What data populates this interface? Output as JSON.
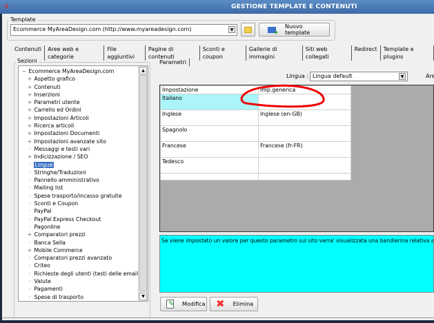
{
  "window": {
    "title": "GESTIONE TEMPLATE E CONTENUTI"
  },
  "template": {
    "group_label": "Template",
    "selected": "Ecommerce MyAreaDesign.com (http://www.myareadesign.com)",
    "new_button": "Nuovo template"
  },
  "tabs": [
    "Contenuti",
    "Aree web e categorie",
    "File aggiuntivi",
    "Pagine di contenuti",
    "Sconti e coupon",
    "Gallerie di immagini",
    "Siti web collegati",
    "Redirect",
    "Template e plugins"
  ],
  "sections": {
    "group_label": "Sezioni",
    "root": "Ecommerce MyAreaDesign.com",
    "items": [
      {
        "label": "Aspetto grafico",
        "expandable": true
      },
      {
        "label": "Contenuti",
        "expandable": true
      },
      {
        "label": "Inserzioni",
        "expandable": true
      },
      {
        "label": "Parametri utente",
        "expandable": true
      },
      {
        "label": "Carrello ed Ordini",
        "expandable": true
      },
      {
        "label": "Impostazioni Articoli",
        "expandable": true
      },
      {
        "label": "Ricerca articoli",
        "expandable": true
      },
      {
        "label": "Impostazioni Documenti",
        "expandable": true
      },
      {
        "label": "Impostazioni avanzate sito",
        "expandable": true
      },
      {
        "label": "Messaggi e testi vari",
        "expandable": false
      },
      {
        "label": "Indicizzazione / SEO",
        "expandable": true
      },
      {
        "label": "Lingue",
        "expandable": false,
        "selected": true
      },
      {
        "label": "Stringhe/Traduzioni",
        "expandable": false
      },
      {
        "label": "Pannello amministrativo",
        "expandable": false
      },
      {
        "label": "Mailing list",
        "expandable": false
      },
      {
        "label": "Spese trasporto/incasso gratuite",
        "expandable": false
      },
      {
        "label": "Sconti e Coupon",
        "expandable": false
      },
      {
        "label": "PayPal",
        "expandable": false
      },
      {
        "label": "PayPal Express Checkout",
        "expandable": false
      },
      {
        "label": "Pagonline",
        "expandable": false
      },
      {
        "label": "Comparatori prezzi",
        "expandable": true
      },
      {
        "label": "Banca Sella",
        "expandable": false
      },
      {
        "label": "Mobile Commerce",
        "expandable": true
      },
      {
        "label": "Comparatori prezzi avanzato",
        "expandable": false
      },
      {
        "label": "Criteo",
        "expandable": false
      },
      {
        "label": "Richieste degli utenti (testi delle email)",
        "expandable": false
      },
      {
        "label": "Valute",
        "expandable": false
      },
      {
        "label": "Pagamenti",
        "expandable": false
      },
      {
        "label": "Spese di trasporto",
        "expandable": false
      }
    ]
  },
  "params": {
    "tab": "Parametri",
    "lingua_label": "Lingua :",
    "lingua_value": "Lingua default",
    "area_label": "Are",
    "columns": [
      "Impostazione",
      "Imp.generica"
    ],
    "rows": [
      [
        "Italiano",
        ""
      ],
      [
        "Inglese",
        "Inglese (en-GB)"
      ],
      [
        "Spagnolo",
        ""
      ],
      [
        "Francese",
        "Francese (fr-FR)"
      ],
      [
        "Tedesco",
        ""
      ]
    ],
    "info": "Se viene impostato un valore per questo parametro sul sito verra' visualizzata una bandierina relativa alla lingua italiana",
    "modify_button": "Modifica",
    "delete_button": "Elimina"
  }
}
